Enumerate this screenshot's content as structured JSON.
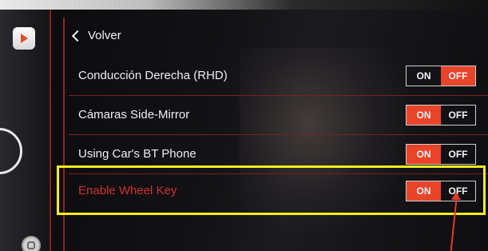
{
  "header": {
    "back_label": "Volver"
  },
  "settings": [
    {
      "label": "Conducción Derecha (RHD)",
      "on": "ON",
      "off": "OFF",
      "state": "off"
    },
    {
      "label": "Cámaras Side-Mirror",
      "on": "ON",
      "off": "OFF",
      "state": "on"
    },
    {
      "label": "Using Car's BT Phone",
      "on": "ON",
      "off": "OFF",
      "state": "on"
    },
    {
      "label": "Enable Wheel Key",
      "on": "ON",
      "off": "OFF",
      "state": "on"
    }
  ],
  "colors": {
    "accent": "#e8442a",
    "highlight_box": "#f5ee1c",
    "highlight_label": "#d0302f",
    "divider": "#7a2020"
  },
  "icons": {
    "dock_app": "play-app-icon",
    "dock_home": "home-button-icon",
    "back": "chevron-left-icon",
    "annotation": "arrow-up-icon"
  }
}
